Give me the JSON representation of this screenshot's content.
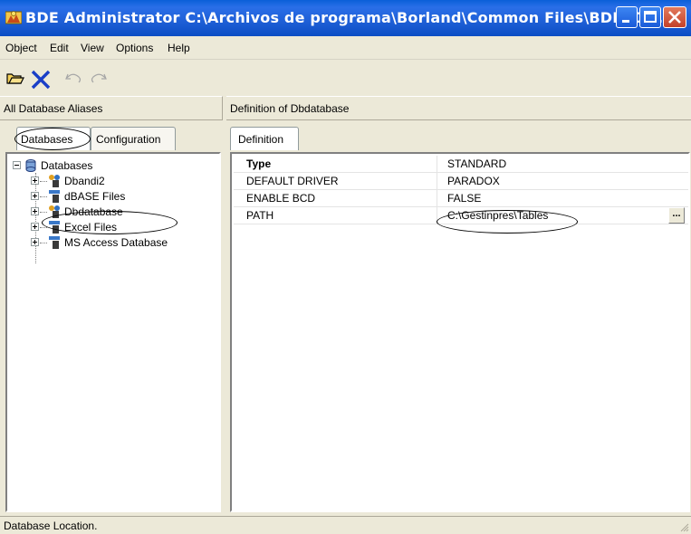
{
  "window": {
    "title": "BDE Administrator  C:\\Archivos de programa\\Borland\\Common Files\\BDE\\IDA..."
  },
  "menu": [
    "Object",
    "Edit",
    "View",
    "Options",
    "Help"
  ],
  "toolbar": {
    "icons": [
      "open-folder-icon",
      "delete-x-icon",
      "undo-icon",
      "redo-icon"
    ]
  },
  "left_header": "All Database Aliases",
  "right_header": "Definition of Dbdatabase",
  "left_tabs": [
    "Databases",
    "Configuration"
  ],
  "right_tab": "Definition",
  "tree": {
    "root": "Databases",
    "items": [
      "Dbandi2",
      "dBASE Files",
      "Dbdatabase",
      "Excel Files",
      "MS Access Database"
    ],
    "selected": "Dbdatabase"
  },
  "definition": {
    "header_key": "Type",
    "header_value": "STANDARD",
    "rows": [
      {
        "key": "DEFAULT DRIVER",
        "value": "PARADOX"
      },
      {
        "key": "ENABLE BCD",
        "value": "FALSE"
      },
      {
        "key": "PATH",
        "value": "C:\\Gestinpres\\Tables"
      }
    ],
    "ellipsis": "..."
  },
  "status": "Database Location.",
  "colors": {
    "titlebar": "#0a5fd8",
    "face": "#ece9d8",
    "close": "#c4412a"
  }
}
